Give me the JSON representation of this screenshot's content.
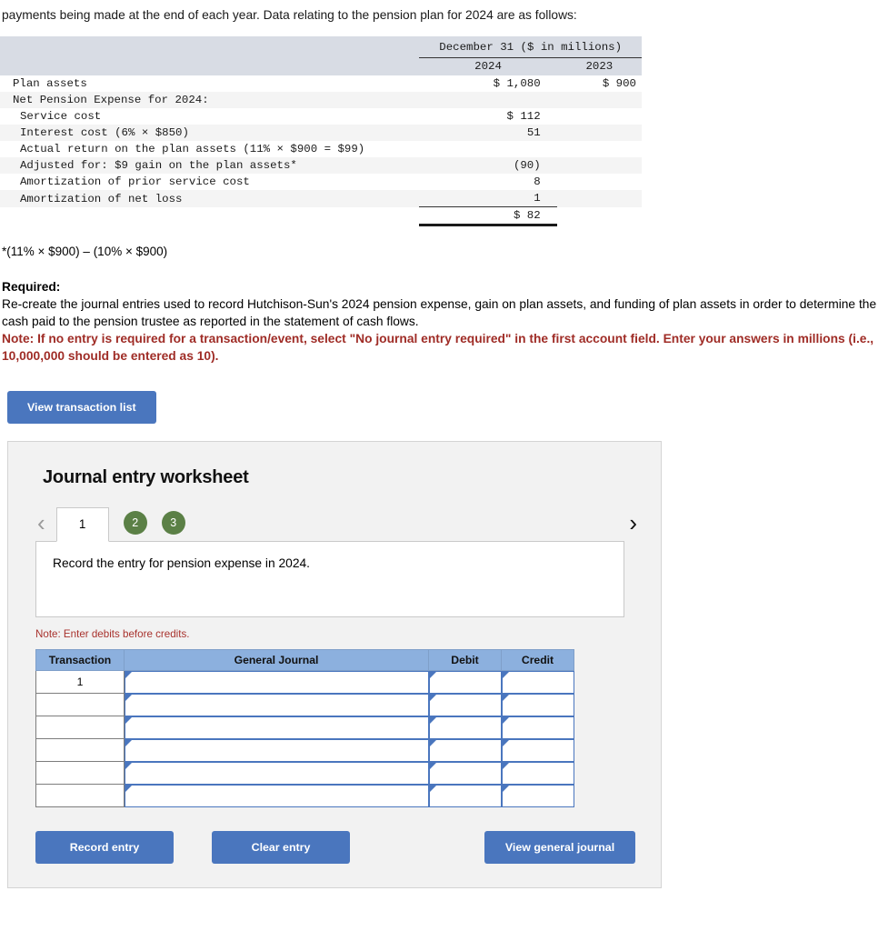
{
  "intro": {
    "text": "payments being made at the end of each year. Data relating to the pension plan for 2024 are as follows:"
  },
  "fin_table": {
    "header_title": "December 31 ($ in millions)",
    "year_2024": "2024",
    "year_2023": "2023",
    "rows": [
      {
        "label": "Plan assets",
        "indent": 0,
        "c1": "$ 1,080",
        "c2": "$ 900"
      },
      {
        "label": "Net Pension Expense for 2024:",
        "indent": 0,
        "c1": "",
        "c2": ""
      },
      {
        "label": "Service cost",
        "indent": 1,
        "c1": "$ 112",
        "c2": ""
      },
      {
        "label": "Interest cost (6% × $850)",
        "indent": 1,
        "c1": "51",
        "c2": ""
      },
      {
        "label": "Actual return on the plan assets (11% × $900 = $99)",
        "indent": 1,
        "c1": "",
        "c2": ""
      },
      {
        "label": "Adjusted for: $9 gain on the plan assets*",
        "indent": 1,
        "c1": "(90)",
        "c2": ""
      },
      {
        "label": "Amortization of prior service cost",
        "indent": 1,
        "c1": "8",
        "c2": ""
      },
      {
        "label": "Amortization of net loss",
        "indent": 1,
        "c1": "1",
        "c2": ""
      }
    ],
    "total": "$ 82"
  },
  "footnote": "*(11% × $900) – (10% × $900)",
  "required": {
    "heading": "Required:",
    "body": "Re-create the journal entries used to record Hutchison-Sun's 2024 pension expense, gain on plan assets, and funding of plan assets in order to determine the cash paid to the pension trustee as reported in the statement of cash flows.",
    "note": "Note: If no entry is required for a transaction/event, select \"No journal entry required\" in the first account field. Enter your answers in millions (i.e., 10,000,000 should be entered as 10).",
    "note_color": "#9f2c26"
  },
  "view_transaction_list_label": "View transaction list",
  "worksheet": {
    "title": "Journal entry worksheet",
    "prev_arrow": "‹",
    "next_arrow": "›",
    "tabs": [
      {
        "label": "1",
        "state": "active"
      },
      {
        "label": "2",
        "state": "complete"
      },
      {
        "label": "3",
        "state": "complete"
      }
    ],
    "tab_complete_color": "#5b8046",
    "prompt": "Record the entry for pension expense in 2024.",
    "note_debits": "Note: Enter debits before credits.",
    "table": {
      "headers": [
        "Transaction",
        "General Journal",
        "Debit",
        "Credit"
      ],
      "header_color": "#8cb0de",
      "rows": [
        {
          "transaction": "1",
          "general_journal": "",
          "debit": "",
          "credit": ""
        },
        {
          "transaction": "",
          "general_journal": "",
          "debit": "",
          "credit": ""
        },
        {
          "transaction": "",
          "general_journal": "",
          "debit": "",
          "credit": ""
        },
        {
          "transaction": "",
          "general_journal": "",
          "debit": "",
          "credit": ""
        },
        {
          "transaction": "",
          "general_journal": "",
          "debit": "",
          "credit": ""
        },
        {
          "transaction": "",
          "general_journal": "",
          "debit": "",
          "credit": ""
        }
      ]
    },
    "actions": {
      "record": "Record entry",
      "clear": "Clear entry",
      "view_general_journal": "View general journal"
    },
    "button_color": "#4a76be"
  }
}
